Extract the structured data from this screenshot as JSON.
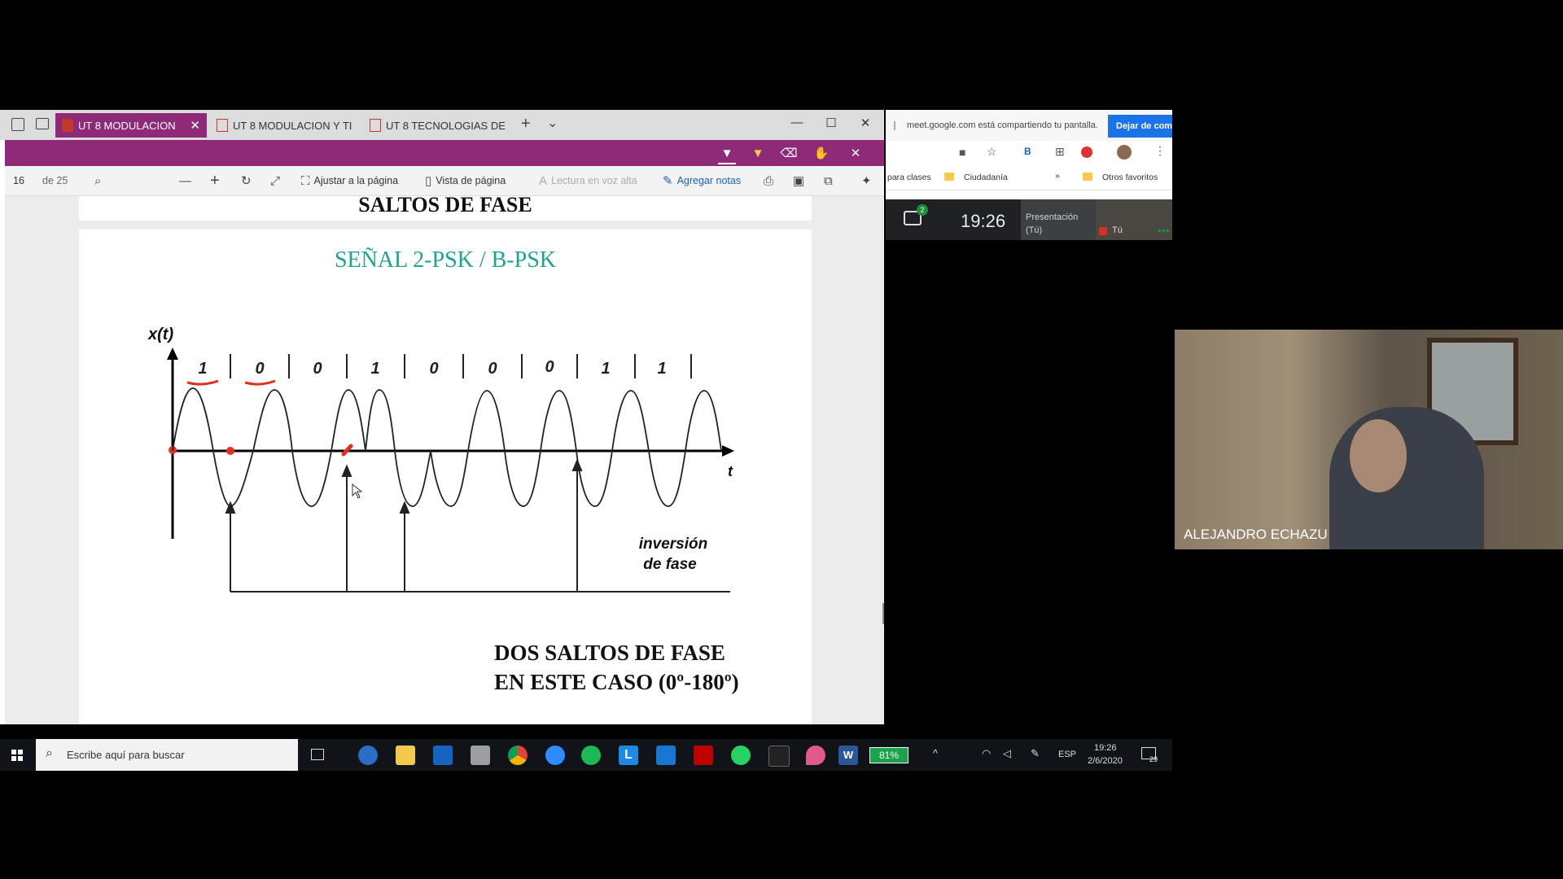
{
  "edge": {
    "tabs": [
      {
        "label": "UT 8 MODULACION",
        "active": true
      },
      {
        "label": "UT 8 MODULACION Y TI",
        "active": false
      },
      {
        "label": "UT 8 TECNOLOGIAS DE",
        "active": false
      }
    ],
    "new_tab": "+",
    "tab_menu": "⌄"
  },
  "pdf_toolbar": {
    "page_current": "16",
    "page_total": "de 25",
    "fit_page": "Ajustar a la página",
    "page_view": "Vista de página",
    "read_aloud": "Lectura en voz alta",
    "add_notes": "Agregar notas"
  },
  "slide_prev": {
    "title": "SALTOS DE FASE"
  },
  "slide": {
    "title": "SEÑAL 2-PSK / B-PSK",
    "y_axis_label": "x(t)",
    "x_axis_label": "t",
    "bits": [
      "1",
      "0",
      "0",
      "1",
      "0",
      "0",
      "0",
      "1",
      "1"
    ],
    "annotation_line1": "inversión",
    "annotation_line2": "de fase",
    "footer_line1": "DOS SALTOS DE FASE",
    "footer_line2": "EN ESTE CASO (0º-180º)"
  },
  "taskbar": {
    "search_placeholder": "Escribe aquí para buscar",
    "battery": "81%",
    "language": "ESP",
    "time": "19:26",
    "date": "2/6/2020",
    "notifications": "29"
  },
  "meet": {
    "share_notice": "meet.google.com está compartiendo tu pantalla.",
    "stop_button": "Dejar de com",
    "bookmarks": [
      "para clases",
      "Ciudadanía"
    ],
    "bookmarks_more": "»",
    "other_bookmarks": "Otros favoritos",
    "chat_badge": "2",
    "clock": "19:26",
    "presentation_label": "Presentación",
    "presentation_sub": "(Tú)",
    "self_label": "Tú"
  },
  "video": {
    "participant_name": "ALEJANDRO ECHAZU"
  },
  "colors": {
    "accent_purple": "#8f2a78",
    "slide_title_green": "#1aa58c",
    "meet_blue": "#1a73e8",
    "annotation_red": "#e0301e"
  }
}
